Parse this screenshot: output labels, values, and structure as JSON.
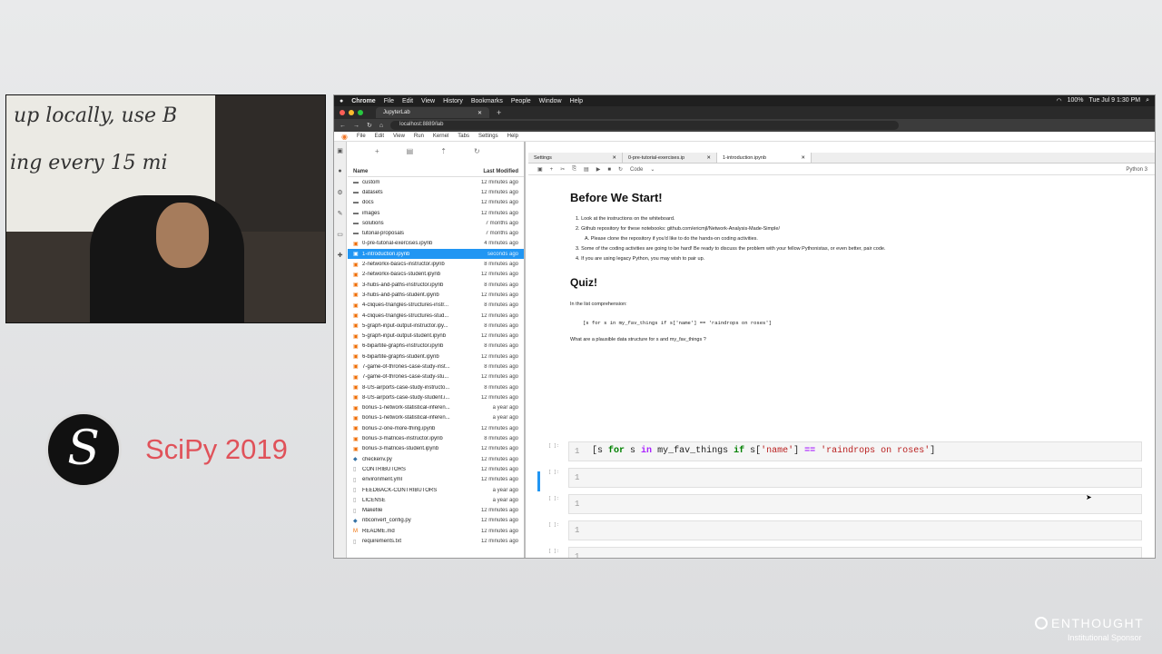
{
  "webcam": {
    "whiteboard_line1": "up locally, use B",
    "whiteboard_line2": "ing every 15 mi"
  },
  "branding": {
    "conference": "SciPy 2019",
    "sponsor": "ENTHOUGHT",
    "sponsor_sub": "Institutional Sponsor"
  },
  "mac": {
    "menu": [
      "Chrome",
      "File",
      "Edit",
      "View",
      "History",
      "Bookmarks",
      "People",
      "Window",
      "Help"
    ],
    "battery": "100%",
    "clock": "Tue Jul 9  1:30 PM"
  },
  "browser": {
    "tab_title": "JupyterLab",
    "url": "localhost:8889/lab"
  },
  "jupyter_menu": [
    "File",
    "Edit",
    "View",
    "Run",
    "Kernel",
    "Tabs",
    "Settings",
    "Help"
  ],
  "filebrowser": {
    "col_name": "Name",
    "col_modified": "Last Modified",
    "files": [
      {
        "name": "custom",
        "mod": "12 minutes ago",
        "icon": "folder"
      },
      {
        "name": "datasets",
        "mod": "12 minutes ago",
        "icon": "folder"
      },
      {
        "name": "docs",
        "mod": "12 minutes ago",
        "icon": "folder"
      },
      {
        "name": "images",
        "mod": "12 minutes ago",
        "icon": "folder"
      },
      {
        "name": "solutions",
        "mod": "7 months ago",
        "icon": "folder"
      },
      {
        "name": "tutorial-proposals",
        "mod": "7 months ago",
        "icon": "folder"
      },
      {
        "name": "0-pre-tutorial-exercises.ipynb",
        "mod": "4 minutes ago",
        "icon": "notebook"
      },
      {
        "name": "1-introduction.ipynb",
        "mod": "seconds ago",
        "icon": "notebook",
        "selected": true
      },
      {
        "name": "2-networkx-basics-instructor.ipynb",
        "mod": "8 minutes ago",
        "icon": "notebook"
      },
      {
        "name": "2-networkx-basics-student.ipynb",
        "mod": "12 minutes ago",
        "icon": "notebook"
      },
      {
        "name": "3-hubs-and-paths-instructor.ipynb",
        "mod": "8 minutes ago",
        "icon": "notebook"
      },
      {
        "name": "3-hubs-and-paths-student.ipynb",
        "mod": "12 minutes ago",
        "icon": "notebook"
      },
      {
        "name": "4-cliques-triangles-structures-instr...",
        "mod": "8 minutes ago",
        "icon": "notebook"
      },
      {
        "name": "4-cliques-triangles-structures-stud...",
        "mod": "12 minutes ago",
        "icon": "notebook"
      },
      {
        "name": "5-graph-input-output-instructor.ipy...",
        "mod": "8 minutes ago",
        "icon": "notebook"
      },
      {
        "name": "5-graph-input-output-student.ipynb",
        "mod": "12 minutes ago",
        "icon": "notebook"
      },
      {
        "name": "6-bipartite-graphs-instructor.ipynb",
        "mod": "8 minutes ago",
        "icon": "notebook"
      },
      {
        "name": "6-bipartite-graphs-student.ipynb",
        "mod": "12 minutes ago",
        "icon": "notebook"
      },
      {
        "name": "7-game-of-thrones-case-study-inst...",
        "mod": "8 minutes ago",
        "icon": "notebook"
      },
      {
        "name": "7-game-of-thrones-case-study-stu...",
        "mod": "12 minutes ago",
        "icon": "notebook"
      },
      {
        "name": "8-US-airports-case-study-instructo...",
        "mod": "8 minutes ago",
        "icon": "notebook"
      },
      {
        "name": "8-US-airports-case-study-student.i...",
        "mod": "12 minutes ago",
        "icon": "notebook"
      },
      {
        "name": "bonus-1-network-statistical-inferen...",
        "mod": "a year ago",
        "icon": "notebook"
      },
      {
        "name": "bonus-1-network-statistical-inferen...",
        "mod": "a year ago",
        "icon": "notebook"
      },
      {
        "name": "bonus-2-one-more-thing.ipynb",
        "mod": "12 minutes ago",
        "icon": "notebook"
      },
      {
        "name": "bonus-3-matrices-instructor.ipynb",
        "mod": "8 minutes ago",
        "icon": "notebook"
      },
      {
        "name": "bonus-3-matrices-student.ipynb",
        "mod": "12 minutes ago",
        "icon": "notebook"
      },
      {
        "name": "checkenv.py",
        "mod": "12 minutes ago",
        "icon": "python"
      },
      {
        "name": "CONTRIBUTORS",
        "mod": "12 minutes ago",
        "icon": "file"
      },
      {
        "name": "environment.yml",
        "mod": "12 minutes ago",
        "icon": "file"
      },
      {
        "name": "FEEDBACK-CONTRIBUTORS",
        "mod": "a year ago",
        "icon": "file"
      },
      {
        "name": "LICENSE",
        "mod": "a year ago",
        "icon": "file"
      },
      {
        "name": "Makefile",
        "mod": "12 minutes ago",
        "icon": "file"
      },
      {
        "name": "nbconvert_config.py",
        "mod": "12 minutes ago",
        "icon": "python"
      },
      {
        "name": "README.md",
        "mod": "12 minutes ago",
        "icon": "markdown"
      },
      {
        "name": "requirements.txt",
        "mod": "12 minutes ago",
        "icon": "file"
      }
    ]
  },
  "tabs": [
    {
      "label": "Settings",
      "active": false
    },
    {
      "label": "0-pre-tutorial-exercises.ip",
      "active": false
    },
    {
      "label": "1-introduction.ipynb",
      "active": true
    }
  ],
  "toolbar": {
    "cell_type": "Code",
    "kernel": "Python 3"
  },
  "notebook": {
    "h1": "Before We Start!",
    "li1": "1. Look at the instructions on the whiteboard.",
    "li2": "2. Github repository for these notebooks: github.com/ericmjl/Network-Analysis-Made-Simple/",
    "li2a": "A. Please clone the repository if you'd like to do the hands-on coding activities.",
    "li3": "3. Some of the coding activities are going to be hard! Be ready to discuss the problem with your fellow Pythonistas, or even better, pair code.",
    "li4": "4. If you are using legacy Python, you may wish to pair up.",
    "h2": "Quiz!",
    "p1": "In the list comprehension:",
    "code1": "[s for s in my_fav_things if s['name'] == 'raindrops on roses']",
    "p2": "What are a plausible data structure for  s  and  my_fav_things ?",
    "cell_prompt": "[ ]:",
    "cell_line": "1"
  }
}
